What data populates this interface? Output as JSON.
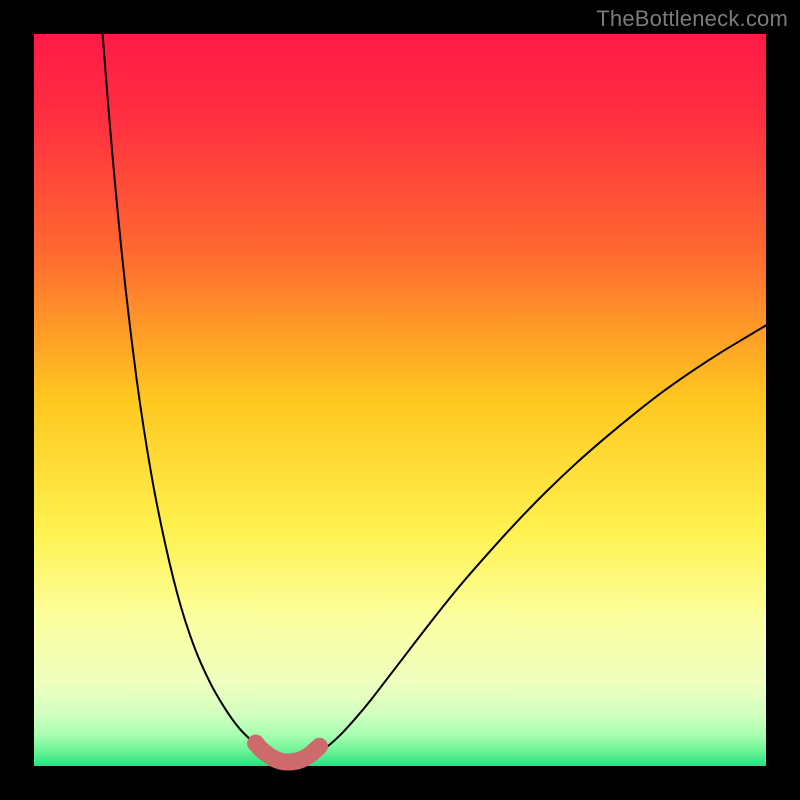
{
  "watermark": "TheBottleneck.com",
  "colors": {
    "frame": "#000000",
    "curve_stroke": "#000000",
    "marker_stroke": "#cf6a6c",
    "marker_fill": "#cf6a6c",
    "gradient_stops": [
      {
        "offset": 0.0,
        "color": "#ff1a46"
      },
      {
        "offset": 0.12,
        "color": "#ff3040"
      },
      {
        "offset": 0.3,
        "color": "#ff6a30"
      },
      {
        "offset": 0.5,
        "color": "#ffc820"
      },
      {
        "offset": 0.68,
        "color": "#fff250"
      },
      {
        "offset": 0.8,
        "color": "#fbffa0"
      },
      {
        "offset": 0.885,
        "color": "#f0ffbf"
      },
      {
        "offset": 0.93,
        "color": "#d0ffc0"
      },
      {
        "offset": 0.958,
        "color": "#a6ffb0"
      },
      {
        "offset": 0.978,
        "color": "#70f599"
      },
      {
        "offset": 1.0,
        "color": "#28e080"
      }
    ]
  },
  "chart_data": {
    "type": "line",
    "title": "",
    "xlabel": "",
    "ylabel": "",
    "xlim": [
      0,
      100
    ],
    "ylim": [
      0,
      100
    ],
    "grid": false,
    "x": [
      0,
      2,
      4,
      6,
      8,
      10,
      12,
      14,
      16,
      18,
      20,
      22,
      24,
      26,
      28,
      30,
      31,
      32,
      33,
      34,
      35,
      36,
      37,
      38,
      40,
      42,
      44,
      46,
      48,
      50,
      54,
      58,
      62,
      66,
      70,
      74,
      78,
      82,
      86,
      90,
      94,
      98,
      100
    ],
    "series": [
      {
        "name": "curve",
        "values": [
          420,
          300,
          220,
          160,
          120,
          92,
          70,
          53,
          40,
          30,
          22,
          16,
          11.5,
          8,
          5.2,
          3.2,
          2.4,
          1.7,
          1.2,
          0.8,
          0.6,
          0.6,
          0.8,
          1.3,
          2.6,
          4.4,
          6.6,
          9.0,
          11.6,
          14.2,
          19.4,
          24.4,
          29.0,
          33.4,
          37.5,
          41.3,
          44.8,
          48.1,
          51.2,
          54.0,
          56.6,
          59.0,
          60.2
        ]
      }
    ],
    "markers": {
      "name": "highlight",
      "color": "#cf6a6c",
      "points": [
        {
          "x": 30.3,
          "y": 3.1,
          "r": 1.0
        },
        {
          "x": 31.0,
          "y": 2.3,
          "r": 1.35
        },
        {
          "x": 32.0,
          "y": 1.5,
          "r": 1.35
        },
        {
          "x": 33.0,
          "y": 0.9,
          "r": 1.35
        },
        {
          "x": 34.0,
          "y": 0.6,
          "r": 1.35
        },
        {
          "x": 35.0,
          "y": 0.55,
          "r": 1.35
        },
        {
          "x": 36.0,
          "y": 0.7,
          "r": 1.35
        },
        {
          "x": 37.0,
          "y": 1.1,
          "r": 1.35
        },
        {
          "x": 38.0,
          "y": 1.8,
          "r": 1.35
        },
        {
          "x": 39.0,
          "y": 2.7,
          "r": 1.35
        }
      ]
    }
  }
}
